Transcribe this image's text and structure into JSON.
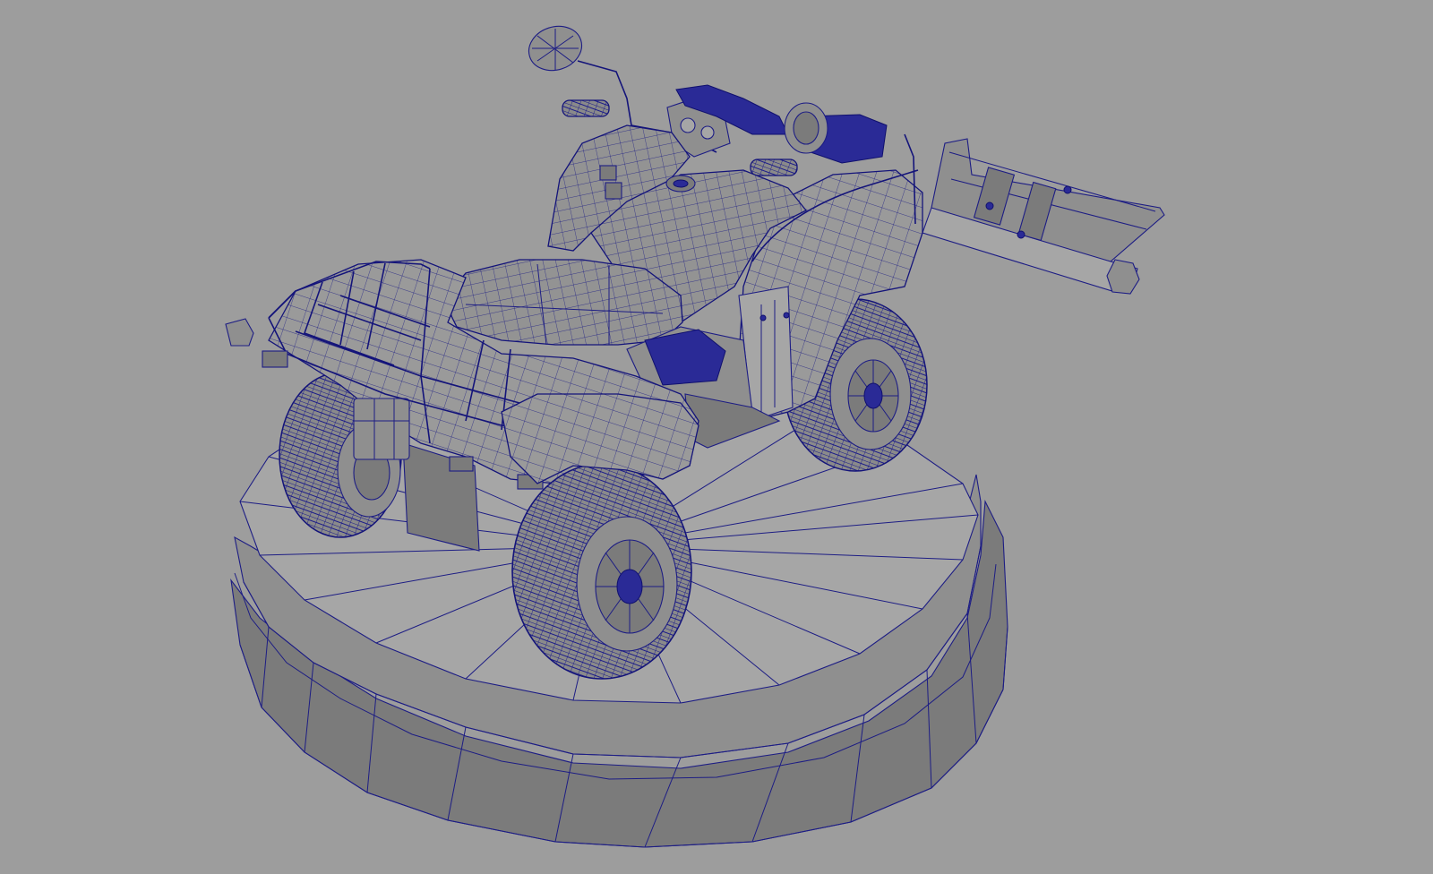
{
  "viewport": {
    "background_color": "#9d9d9d",
    "wireframe_color": "#1d1d84",
    "shaded_color": "#8f8f8f"
  },
  "scene": {
    "objects": [
      "atv-quad-bike",
      "display-pedestal"
    ]
  }
}
